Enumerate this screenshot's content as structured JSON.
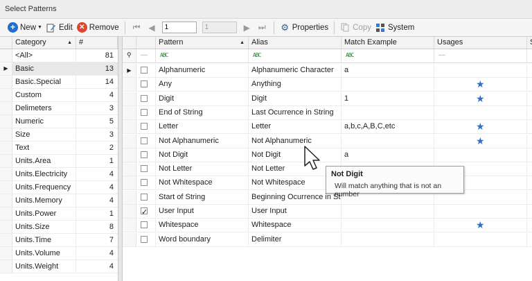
{
  "window": {
    "title": "Select Patterns"
  },
  "toolbar": {
    "new_label": "New",
    "edit_label": "Edit",
    "remove_label": "Remove",
    "page_current": "1",
    "page_total": "1",
    "properties_label": "Properties",
    "copy_label": "Copy",
    "system_label": "System"
  },
  "categories": {
    "headers": {
      "category": "Category",
      "count": "#"
    },
    "rows": [
      {
        "name": "<All>",
        "count": "81"
      },
      {
        "name": "Basic",
        "count": "13"
      },
      {
        "name": "Basic.Special",
        "count": "14"
      },
      {
        "name": "Custom",
        "count": "4"
      },
      {
        "name": "Delimeters",
        "count": "3"
      },
      {
        "name": "Numeric",
        "count": "5"
      },
      {
        "name": "Size",
        "count": "3"
      },
      {
        "name": "Text",
        "count": "2"
      },
      {
        "name": "Units.Area",
        "count": "1"
      },
      {
        "name": "Units.Electricity",
        "count": "4"
      },
      {
        "name": "Units.Frequency",
        "count": "4"
      },
      {
        "name": "Units.Memory",
        "count": "4"
      },
      {
        "name": "Units.Power",
        "count": "1"
      },
      {
        "name": "Units.Size",
        "count": "8"
      },
      {
        "name": "Units.Time",
        "count": "7"
      },
      {
        "name": "Units.Volume",
        "count": "4"
      },
      {
        "name": "Units.Weight",
        "count": "4"
      }
    ]
  },
  "patterns": {
    "headers": {
      "pattern": "Pattern",
      "alias": "Alias",
      "match": "Match Example",
      "usages": "Usages",
      "s": "S"
    },
    "filter_icon": "ABC",
    "rows": [
      {
        "pattern": "Alphanumeric",
        "alias": "Alphanumeric Character",
        "match": "a",
        "checked": false,
        "usage": false
      },
      {
        "pattern": "Any",
        "alias": "Anything",
        "match": "",
        "checked": false,
        "usage": true
      },
      {
        "pattern": "Digit",
        "alias": "Digit",
        "match": "1",
        "checked": false,
        "usage": true
      },
      {
        "pattern": "End of String",
        "alias": "Last Ocurrence in String",
        "match": "",
        "checked": false,
        "usage": false
      },
      {
        "pattern": "Letter",
        "alias": "Letter",
        "match": "a,b,c,A,B,C,etc",
        "checked": false,
        "usage": true
      },
      {
        "pattern": "Not Alphanumeric",
        "alias": "Not Alphanumeric",
        "match": "",
        "checked": false,
        "usage": true
      },
      {
        "pattern": "Not Digit",
        "alias": "Not Digit",
        "match": "a",
        "checked": false,
        "usage": false
      },
      {
        "pattern": "Not Letter",
        "alias": "Not Letter",
        "match": "",
        "checked": false,
        "usage": false
      },
      {
        "pattern": "Not Whitespace",
        "alias": "Not Whitespace",
        "match": "",
        "checked": false,
        "usage": false
      },
      {
        "pattern": "Start of String",
        "alias": "Beginning Ocurrence in String",
        "match": "",
        "checked": false,
        "usage": false
      },
      {
        "pattern": "User Input",
        "alias": "User Input",
        "match": "",
        "checked": true,
        "usage": false
      },
      {
        "pattern": "Whitespace",
        "alias": "Whitespace",
        "match": "",
        "checked": false,
        "usage": true
      },
      {
        "pattern": "Word boundary",
        "alias": "Delimiter",
        "match": "",
        "checked": false,
        "usage": false
      }
    ]
  },
  "tooltip": {
    "title": "Not Digit",
    "text": "Will match anything that is not an number"
  },
  "colors": {
    "star": "#2f6fc9",
    "new_icon": "#1f6fd1",
    "remove_icon": "#e0452b"
  }
}
